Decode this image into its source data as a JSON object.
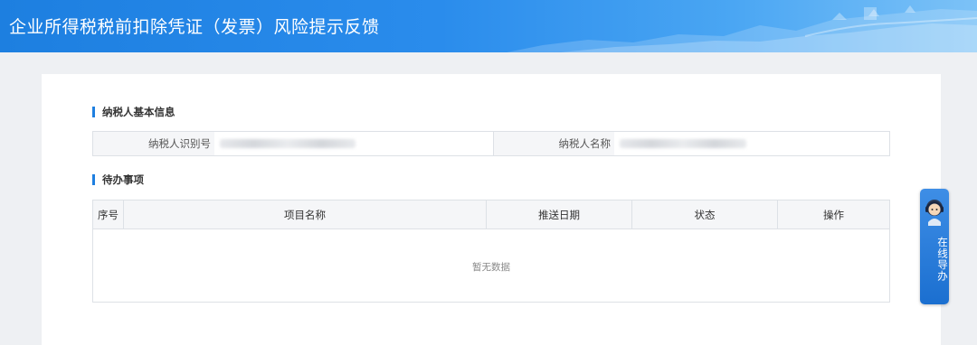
{
  "header": {
    "title": "企业所得税税前扣除凭证（发票）风险提示反馈"
  },
  "taxpayer_info": {
    "section_title": "纳税人基本信息",
    "id_label": "纳税人识别号",
    "name_label": "纳税人名称"
  },
  "todo": {
    "section_title": "待办事项",
    "columns": [
      "序号",
      "项目名称",
      "推送日期",
      "状态",
      "操作"
    ],
    "empty_text": "暂无数据"
  },
  "online_guide": {
    "label": "在线导办"
  },
  "colors": {
    "accent": "#1e7fe0",
    "header_bg": "#2a8cec"
  }
}
